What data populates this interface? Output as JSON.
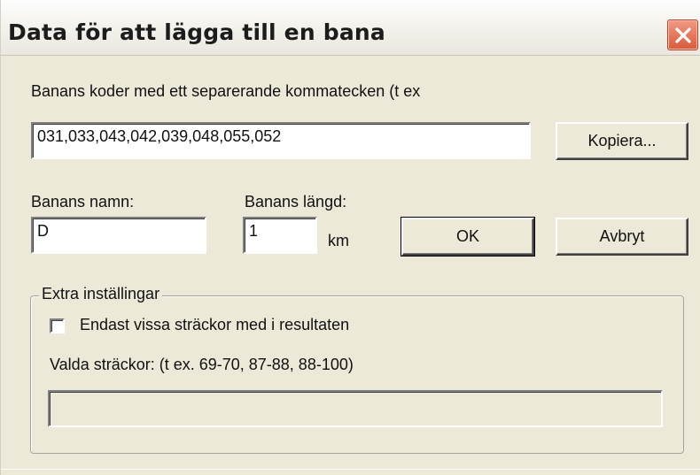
{
  "window": {
    "title": "Data för att lägga till en bana"
  },
  "codes": {
    "instruction": "Banans koder med ett separerande kommatecken (t ex",
    "value": "031,033,043,042,039,048,055,052",
    "copy_button": "Kopiera..."
  },
  "name": {
    "label": "Banans namn:",
    "value": "D"
  },
  "length": {
    "label": "Banans längd:",
    "value": "1",
    "unit": "km"
  },
  "buttons": {
    "ok": "OK",
    "cancel": "Avbryt"
  },
  "extra": {
    "group_title": "Extra inställingar",
    "checkbox_label": "Endast vissa sträckor med i resultaten",
    "checkbox_checked": false,
    "selected_label": "Valda sträckor: (t ex. 69-70, 87-88, 88-100)",
    "selected_value": ""
  },
  "icons": {
    "close": "close-icon"
  },
  "colors": {
    "close_button": "#d95a3a",
    "window_bg": "#ece9d8"
  }
}
